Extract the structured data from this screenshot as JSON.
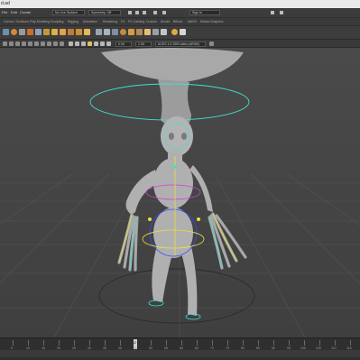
{
  "window": {
    "title": "d.ad"
  },
  "menu": {
    "items": [
      "File",
      "Edit",
      "Create",
      "Select",
      "Modify",
      "Display",
      "Windows",
      "Help"
    ],
    "live_surface": "No Live Surface",
    "symmetry": "Symmetry: Off",
    "signin": "Sign In"
  },
  "shelf_tabs": [
    "Curves / Surfaces",
    "Poly Modeling",
    "Sculpting",
    "Rigging",
    "Animation",
    "Rendering",
    "FX",
    "FX Caching",
    "Custom",
    "Arnold",
    "Bifrost",
    "MASH",
    "Motion Graphics"
  ],
  "viewport_toolbar": {
    "field_a": "0.00",
    "field_b": "1.00",
    "color_space": "ACES 1.0 SDR-video (sRGB)"
  },
  "viewport": {
    "camera_label": "persp"
  },
  "timeline": {
    "ticks": [
      "5",
      "10",
      "15",
      "20",
      "25",
      "30",
      "35",
      "40",
      "45",
      "50",
      "55",
      "60",
      "65",
      "70",
      "75",
      "80",
      "85",
      "90",
      "95",
      "100",
      "105",
      "110",
      "115"
    ],
    "current_frame": "12"
  },
  "colors": {
    "viewport_bg": "#444444",
    "control_yellow": "#e8e040",
    "control_cyan": "#40e0d0",
    "control_magenta": "#d040d0",
    "control_blue": "#3050ff"
  }
}
